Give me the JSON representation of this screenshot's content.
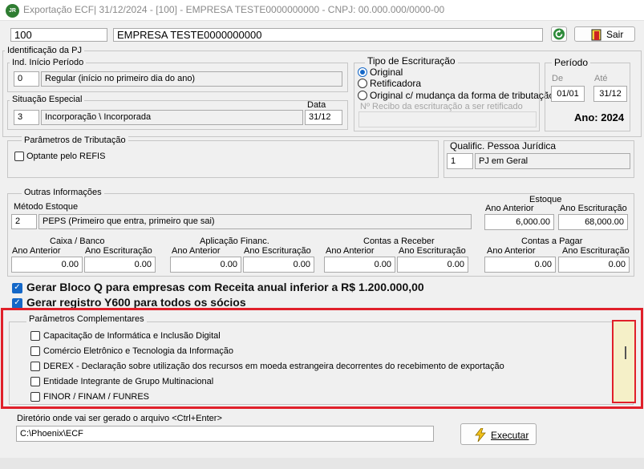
{
  "window": {
    "title": "Exportação ECF|  31/12/2024 - [100] - EMPRESA TESTE0000000000 - CNPJ: 00.000.000/0000-00",
    "app_icon_text": "JR",
    "colors": {
      "highlight": "#e0202a",
      "check_blue": "#1467c7",
      "scroll_track": "#f5f0c8"
    }
  },
  "header": {
    "company_code": "100",
    "company_name": "EMPRESA TESTE0000000000",
    "exit_label": "Sair",
    "refresh_icon": "refresh-icon",
    "exit_icon": "door-exit-icon"
  },
  "identificacao": {
    "label": "Identificação da PJ",
    "inicio": {
      "label": "Ind. Início Período",
      "code": "0",
      "desc": "Regular (início no primeiro dia do ano)"
    },
    "situacao": {
      "label": "Situação Especial",
      "date_label": "Data",
      "code": "3",
      "desc": "Incorporação \\ Incorporada",
      "date": "31/12"
    },
    "tipo": {
      "label": "Tipo de Escrituração",
      "options": [
        "Original",
        "Retificadora",
        "Original c/ mudança da forma de tributação"
      ],
      "selected_index": 0,
      "recibo_label": "Nº Recibo da escrituração a ser retificado",
      "recibo_value": ""
    },
    "periodo": {
      "label": "Período",
      "de_label": "De",
      "ate_label": "Até",
      "de": "01/01",
      "ate": "31/12",
      "ano_text": "Ano: 2024"
    }
  },
  "tributacao": {
    "label": "Parâmetros de Tributação",
    "refis_label": "Optante pelo REFIS",
    "refis_checked": false,
    "qualific_label": "Qualific. Pessoa Jurídica",
    "qualific_code": "1",
    "qualific_desc": "PJ em Geral"
  },
  "outras": {
    "label": "Outras Informações",
    "metodo_label": "Método Estoque",
    "metodo_code": "2",
    "metodo_desc": "PEPS (Primeiro que entra, primeiro que sai)",
    "estoque": {
      "label": "Estoque",
      "anterior_label": "Ano Anterior",
      "escrituracao_label": "Ano Escrituração",
      "anterior": "6,000.00",
      "escrituracao": "68,000.00"
    },
    "groups": [
      {
        "label": "Caixa / Banco",
        "anterior_label": "Ano  Anterior",
        "escrituracao_label": "Ano Escrituração",
        "anterior": "0.00",
        "escrituracao": "0.00"
      },
      {
        "label": "Aplicação Financ.",
        "anterior_label": "Ano  Anterior",
        "escrituracao_label": "Ano Escrituração",
        "anterior": "0.00",
        "escrituracao": "0.00"
      },
      {
        "label": "Contas a Receber",
        "anterior_label": "Ano Anterior",
        "escrituracao_label": "Ano Escrituração",
        "anterior": "0.00",
        "escrituracao": "0.00"
      },
      {
        "label": "Contas a Pagar",
        "anterior_label": "Ano  Anterior",
        "escrituracao_label": "Ano Escrituração",
        "anterior": "0.00",
        "escrituracao": "0.00"
      }
    ]
  },
  "checks": {
    "bloco_q": {
      "label": "Gerar Bloco Q para empresas com Receita anual inferior a R$ 1.200.000,00",
      "checked": true
    },
    "y600": {
      "label": "Gerar registro Y600 para todos os sócios",
      "checked": true
    }
  },
  "complementares": {
    "label": "Parâmetros Complementares",
    "items": [
      {
        "label": "Capacitação de Informática e Inclusão Digital",
        "checked": false
      },
      {
        "label": "Comércio Eletrônico e Tecnologia da Informação",
        "checked": false
      },
      {
        "label": "DEREX - Declaração sobre utilização dos recursos em moeda estrangeira decorrentes do recebimento de exportação",
        "checked": false
      },
      {
        "label": "Entidade Integrante de Grupo Multinacional",
        "checked": false
      },
      {
        "label": "FINOR / FINAM / FUNRES",
        "checked": false
      }
    ]
  },
  "diretorio": {
    "label": "Diretório onde vai ser gerado o arquivo <Ctrl+Enter>",
    "value": "C:\\Phoenix\\ECF",
    "executar_label": "Executar",
    "executar_icon": "lightning-icon"
  }
}
